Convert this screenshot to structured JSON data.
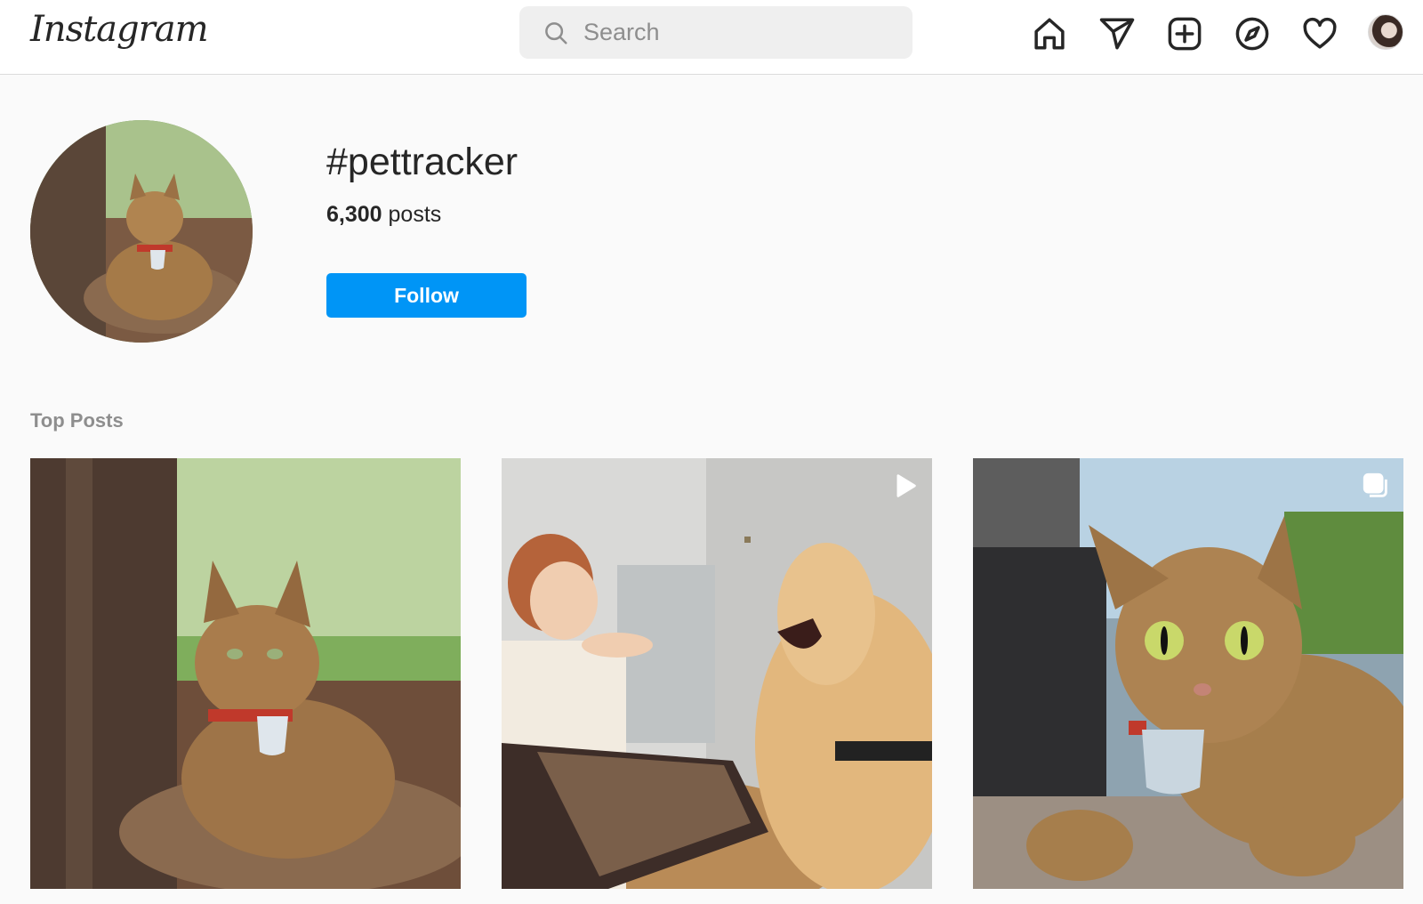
{
  "header": {
    "logo_text": "Instagram",
    "search_placeholder": "Search",
    "nav_icons": [
      "home-icon",
      "direct-send-icon",
      "new-post-icon",
      "explore-compass-icon",
      "activity-heart-icon",
      "profile-avatar"
    ]
  },
  "hashtag": {
    "title": "#pettracker",
    "posts_count": "6,300",
    "posts_label": "posts",
    "follow_label": "Follow"
  },
  "top_posts": {
    "label": "Top Posts",
    "items": [
      {
        "type": "photo",
        "subject": "Bengal cat lying by tree wearing tracker tag"
      },
      {
        "type": "video",
        "badge_icon": "play-icon",
        "subject": "Woman tossing treat to golden retriever"
      },
      {
        "type": "carousel",
        "badge_icon": "carousel-icon",
        "subject": "Bengal cat close-up wearing tracker tag"
      }
    ]
  },
  "colors": {
    "accent": "#0095f6",
    "text": "#262626",
    "muted": "#8e8e8e",
    "background": "#fafafa",
    "border": "#dbdbdb"
  }
}
